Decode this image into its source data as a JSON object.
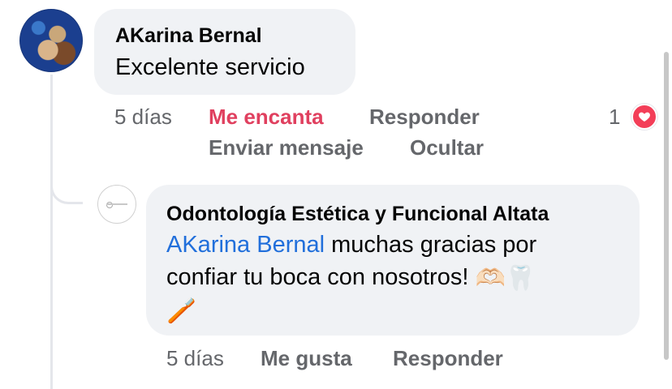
{
  "comment": {
    "author": "AKarina Bernal",
    "text": "Excelente servicio",
    "time": "5 días",
    "reaction_label": "Me encanta",
    "reply_label": "Responder",
    "send_message_label": "Enviar mensaje",
    "hide_label": "Ocultar",
    "reaction_count": "1"
  },
  "reply": {
    "author": "Odontología Estética y Funcional Altata",
    "mention": "AKarina Bernal",
    "text_line1": " muchas gracias por",
    "text_line2": "confiar tu boca con nosotros! ",
    "emoji1": "🫶🏻",
    "emoji2": "🦷",
    "emoji3": "🪥",
    "time": "5 días",
    "like_label": "Me gusta",
    "reply_label": "Responder"
  },
  "icons": {
    "reaction_icon": "heart-icon",
    "tooth_icon": "tooth-icon"
  },
  "colors": {
    "love": "#e0405f",
    "link": "#216fdb",
    "meta": "#65676b",
    "bubble": "#f0f2f5"
  }
}
